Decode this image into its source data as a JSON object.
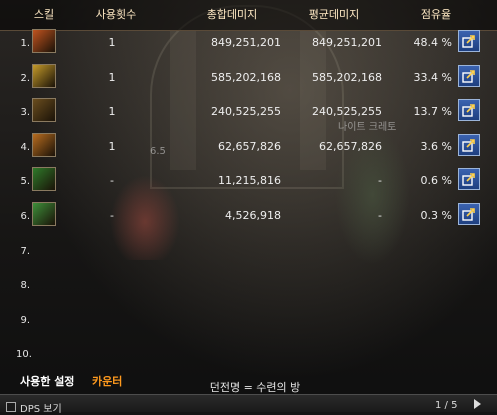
{
  "header": {
    "skill": "스킬",
    "count": "사용횟수",
    "total": "총합데미지",
    "avg": "평균데미지",
    "share": "점유율"
  },
  "rows": [
    {
      "index": "1.",
      "count": "1",
      "total": "849,251,201",
      "avg": "849,251,201",
      "share": "48.4 %",
      "icon_color": "#c0531f",
      "icon": "flame-skill-icon"
    },
    {
      "index": "2.",
      "count": "1",
      "total": "585,202,168",
      "avg": "585,202,168",
      "share": "33.4 %",
      "icon_color": "#c49a2a",
      "icon": "sword-burst-skill-icon"
    },
    {
      "index": "3.",
      "count": "1",
      "total": "240,525,255",
      "avg": "240,525,255",
      "share": "13.7 %",
      "icon_color": "#6a4d1e",
      "icon": "slash-arc-skill-icon"
    },
    {
      "index": "4.",
      "count": "1",
      "total": "62,657,826",
      "avg": "62,657,826",
      "share": "3.6 %",
      "icon_color": "#b86d20",
      "icon": "cross-swords-skill-icon"
    },
    {
      "index": "5.",
      "count": "-",
      "total": "11,215,816",
      "avg": "-",
      "share": "0.6 %",
      "icon_color": "#2f7a2a",
      "icon": "green-blade-skill-icon"
    },
    {
      "index": "6.",
      "count": "-",
      "total": "4,526,918",
      "avg": "-",
      "share": "0.3 %",
      "icon_color": "#3e8f3a",
      "icon": "green-strike-skill-icon"
    },
    {
      "index": "7."
    },
    {
      "index": "8."
    },
    {
      "index": "9."
    },
    {
      "index": "10."
    }
  ],
  "scene_labels": {
    "npc": "나이트 크레토",
    "level": "6.5"
  },
  "tabs": {
    "active": "사용한 설정",
    "counter": "카운터"
  },
  "bottom": {
    "dps_label": "DPS 보기",
    "dungeon": "던전명 = 수련의 방",
    "page": "1 / 5"
  },
  "colors": {
    "header_text": "#ffe9c4",
    "counter_tab": "#ff9a1e",
    "share_button": "#2d55a0"
  }
}
